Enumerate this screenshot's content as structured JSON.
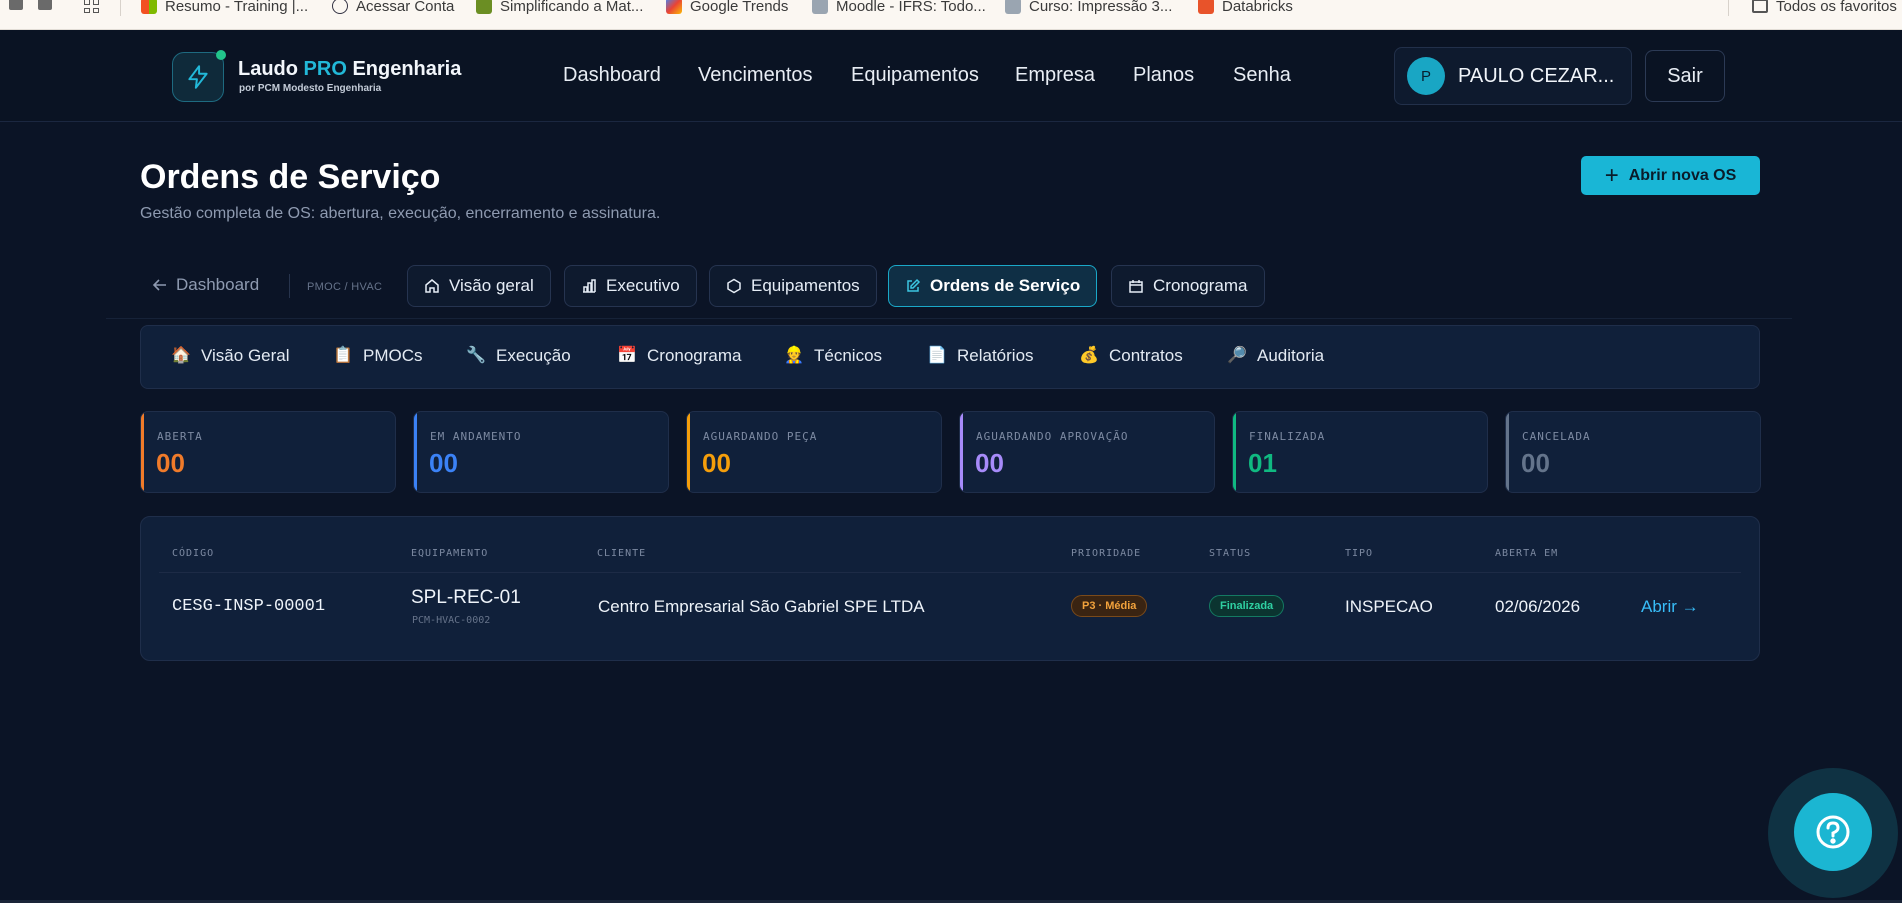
{
  "bookmarks": [
    {
      "label": "Resumo - Training |...",
      "color": "#f25022"
    },
    {
      "label": "Acessar Conta",
      "color": "#e8eef5"
    },
    {
      "label": "Simplificando a Mat...",
      "color": "#6b8e23"
    },
    {
      "label": "Google Trends",
      "color": "#4285f4"
    },
    {
      "label": "Moodle - IFRS: Todo...",
      "color": "#9aa5b1"
    },
    {
      "label": "Curso: Impressão 3...",
      "color": "#9aa5b1"
    },
    {
      "label": "Databricks",
      "color": "#e8532a"
    }
  ],
  "bookmarks_all": "Todos os favoritos",
  "brand": {
    "name_prefix": "Laudo ",
    "name_highlight": "PRO",
    "name_suffix": " Engenharia",
    "subtitle": "por PCM Modesto Engenharia"
  },
  "nav": [
    "Dashboard",
    "Vencimentos",
    "Equipamentos",
    "Empresa",
    "Planos",
    "Senha"
  ],
  "user": {
    "initial": "P",
    "name": "PAULO CEZAR..."
  },
  "logout_label": "Sair",
  "header": {
    "title": "Ordens de Serviço",
    "subtitle": "Gestão completa de OS: abertura, execução, encerramento e assinatura.",
    "new_button": "Abrir nova OS"
  },
  "tabs": {
    "back": "Dashboard",
    "section": "PMOC / HVAC",
    "items": [
      {
        "label": "Visão geral",
        "icon": "home-icon",
        "active": false
      },
      {
        "label": "Executivo",
        "icon": "bar-chart-icon",
        "active": false
      },
      {
        "label": "Equipamentos",
        "icon": "hexagon-icon",
        "active": false
      },
      {
        "label": "Ordens de Serviço",
        "icon": "edit-icon",
        "active": true
      },
      {
        "label": "Cronograma",
        "icon": "calendar-icon",
        "active": false
      }
    ]
  },
  "modules": [
    {
      "label": "Visão Geral",
      "icon": "house-emoji-icon",
      "glyph": "🏠"
    },
    {
      "label": "PMOCs",
      "icon": "clipboard-icon",
      "glyph": "📋"
    },
    {
      "label": "Execução",
      "icon": "wrench-icon",
      "glyph": "🔧"
    },
    {
      "label": "Cronograma",
      "icon": "calendar-emoji-icon",
      "glyph": "📅"
    },
    {
      "label": "Técnicos",
      "icon": "person-icon",
      "glyph": "👷"
    },
    {
      "label": "Relatórios",
      "icon": "document-icon",
      "glyph": "📄"
    },
    {
      "label": "Contratos",
      "icon": "money-bag-icon",
      "glyph": "💰"
    },
    {
      "label": "Auditoria",
      "icon": "magnifier-icon",
      "glyph": "🔎"
    }
  ],
  "stats": [
    {
      "label": "ABERTA",
      "value": "00",
      "color": "#f07b2a"
    },
    {
      "label": "EM ANDAMENTO",
      "value": "00",
      "color": "#3b82f6"
    },
    {
      "label": "AGUARDANDO PEÇA",
      "value": "00",
      "color": "#f59e0b"
    },
    {
      "label": "AGUARDANDO APROVAÇÃO",
      "value": "00",
      "color": "#a78bfa"
    },
    {
      "label": "FINALIZADA",
      "value": "01",
      "color": "#10b981"
    },
    {
      "label": "CANCELADA",
      "value": "00",
      "color": "#64748b"
    }
  ],
  "table": {
    "columns": [
      "CÓDIGO",
      "EQUIPAMENTO",
      "CLIENTE",
      "PRIORIDADE",
      "STATUS",
      "TIPO",
      "ABERTA EM"
    ],
    "rows": [
      {
        "code": "CESG-INSP-00001",
        "equipment": "SPL-REC-01",
        "equipment_code": "PCM-HVAC-0002",
        "client": "Centro Empresarial São Gabriel SPE LTDA",
        "priority": "P3 · Média",
        "status": "Finalizada",
        "type": "INSPECAO",
        "opened": "02/06/2026",
        "action": "Abrir →"
      }
    ]
  }
}
